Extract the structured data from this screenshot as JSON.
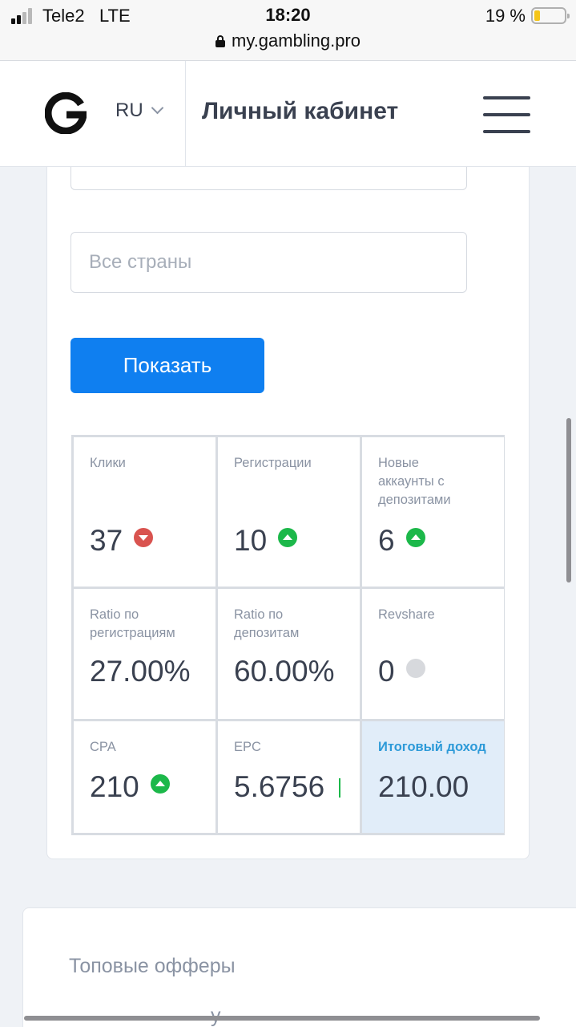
{
  "status_bar": {
    "carrier": "Tele2",
    "network": "LTE",
    "time": "18:20",
    "battery_percent": "19 %",
    "battery_level": 0.19,
    "url": "my.gambling.pro"
  },
  "header": {
    "logo_letter": "G",
    "language": "RU",
    "title": "Личный кабинет"
  },
  "filters": {
    "country_placeholder": "Все страны",
    "show_button": "Показать"
  },
  "stats": [
    {
      "label": "Клики",
      "value": "37",
      "trend": "down"
    },
    {
      "label": "Регистрации",
      "value": "10",
      "trend": "up"
    },
    {
      "label": "Новые аккаунты с депозитами",
      "value": "6",
      "trend": "up"
    },
    {
      "label": "Ratio по регистрациям",
      "value": "27.00%",
      "trend": "none"
    },
    {
      "label": "Ratio по депозитам",
      "value": "60.00%",
      "trend": "none"
    },
    {
      "label": "Revshare",
      "value": "0",
      "trend": "neutral"
    },
    {
      "label": "CPA",
      "value": "210",
      "trend": "up"
    },
    {
      "label": "EPC",
      "value": "5.6756",
      "trend": "bar"
    },
    {
      "label": "Итоговый доход",
      "value": "210.00",
      "trend": "none",
      "highlight": true
    }
  ],
  "offers": {
    "title": "Топовые офферы",
    "partial_text": "у"
  },
  "colors": {
    "primary": "#0f7ff0",
    "trend_up": "#1cb84a",
    "trend_down": "#d9534f",
    "neutral": "#d7d9dd",
    "accent_label": "#2d9ad8",
    "highlight_bg": "#e1edf9"
  }
}
